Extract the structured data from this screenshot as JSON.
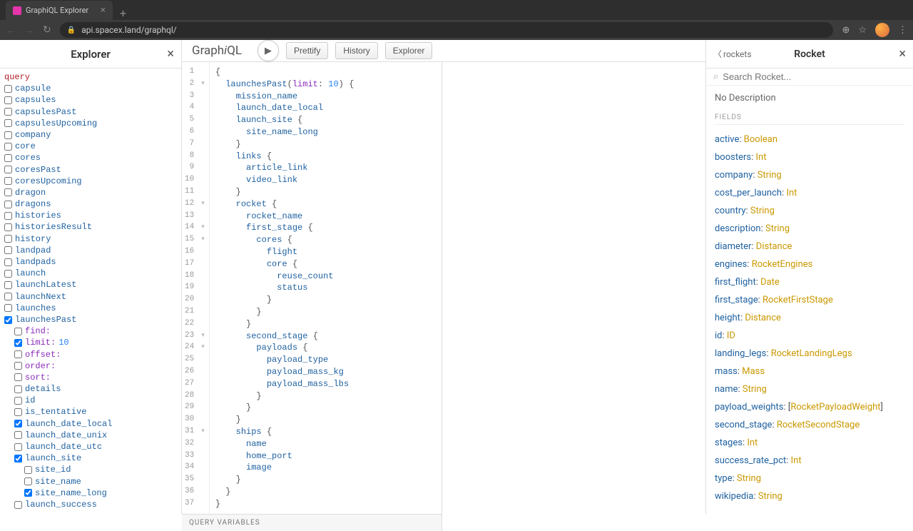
{
  "browser": {
    "tab_title": "GraphiQL Explorer",
    "url": "api.spacex.land/graphql/"
  },
  "explorer": {
    "title": "Explorer",
    "root_keyword": "query",
    "fields": [
      {
        "name": "capsule",
        "indent": 0,
        "checked": false
      },
      {
        "name": "capsules",
        "indent": 0,
        "checked": false
      },
      {
        "name": "capsulesPast",
        "indent": 0,
        "checked": false
      },
      {
        "name": "capsulesUpcoming",
        "indent": 0,
        "checked": false
      },
      {
        "name": "company",
        "indent": 0,
        "checked": false
      },
      {
        "name": "core",
        "indent": 0,
        "checked": false
      },
      {
        "name": "cores",
        "indent": 0,
        "checked": false
      },
      {
        "name": "coresPast",
        "indent": 0,
        "checked": false
      },
      {
        "name": "coresUpcoming",
        "indent": 0,
        "checked": false
      },
      {
        "name": "dragon",
        "indent": 0,
        "checked": false
      },
      {
        "name": "dragons",
        "indent": 0,
        "checked": false
      },
      {
        "name": "histories",
        "indent": 0,
        "checked": false
      },
      {
        "name": "historiesResult",
        "indent": 0,
        "checked": false
      },
      {
        "name": "history",
        "indent": 0,
        "checked": false
      },
      {
        "name": "landpad",
        "indent": 0,
        "checked": false
      },
      {
        "name": "landpads",
        "indent": 0,
        "checked": false
      },
      {
        "name": "launch",
        "indent": 0,
        "checked": false
      },
      {
        "name": "launchLatest",
        "indent": 0,
        "checked": false
      },
      {
        "name": "launchNext",
        "indent": 0,
        "checked": false
      },
      {
        "name": "launches",
        "indent": 0,
        "checked": false
      },
      {
        "name": "launchesPast",
        "indent": 0,
        "checked": true
      },
      {
        "name": "find:",
        "indent": 1,
        "checked": false,
        "arg": true
      },
      {
        "name": "limit:",
        "indent": 1,
        "checked": true,
        "arg": true,
        "value": "10"
      },
      {
        "name": "offset:",
        "indent": 1,
        "checked": false,
        "arg": true
      },
      {
        "name": "order:",
        "indent": 1,
        "checked": false,
        "arg": true
      },
      {
        "name": "sort:",
        "indent": 1,
        "checked": false,
        "arg": true
      },
      {
        "name": "details",
        "indent": 1,
        "checked": false
      },
      {
        "name": "id",
        "indent": 1,
        "checked": false
      },
      {
        "name": "is_tentative",
        "indent": 1,
        "checked": false
      },
      {
        "name": "launch_date_local",
        "indent": 1,
        "checked": true
      },
      {
        "name": "launch_date_unix",
        "indent": 1,
        "checked": false
      },
      {
        "name": "launch_date_utc",
        "indent": 1,
        "checked": false
      },
      {
        "name": "launch_site",
        "indent": 1,
        "checked": true
      },
      {
        "name": "site_id",
        "indent": 2,
        "checked": false
      },
      {
        "name": "site_name",
        "indent": 2,
        "checked": false
      },
      {
        "name": "site_name_long",
        "indent": 2,
        "checked": true
      },
      {
        "name": "launch_success",
        "indent": 1,
        "checked": false
      }
    ]
  },
  "toolbar": {
    "logo": "GraphiQL",
    "prettify": "Prettify",
    "history": "History",
    "explorer": "Explorer"
  },
  "editor": {
    "lines": [
      {
        "n": 1,
        "fold": "",
        "html": "<span class='c-punc'>{</span>"
      },
      {
        "n": 2,
        "fold": "▾",
        "html": "  <span class='c-field'>launchesPast</span><span class='c-punc'>(</span><span class='c-attr'>limit</span><span class='c-punc'>: </span><span class='c-num'>10</span><span class='c-punc'>) {</span>"
      },
      {
        "n": 3,
        "fold": "",
        "html": "    <span class='c-field'>mission_name</span>"
      },
      {
        "n": 4,
        "fold": "",
        "html": "    <span class='c-field'>launch_date_local</span>"
      },
      {
        "n": 5,
        "fold": "",
        "html": "    <span class='c-field'>launch_site</span> <span class='c-punc'>{</span>"
      },
      {
        "n": 6,
        "fold": "",
        "html": "      <span class='c-field'>site_name_long</span>"
      },
      {
        "n": 7,
        "fold": "",
        "html": "    <span class='c-punc'>}</span>"
      },
      {
        "n": 8,
        "fold": "",
        "html": "    <span class='c-field'>links</span> <span class='c-punc'>{</span>"
      },
      {
        "n": 9,
        "fold": "",
        "html": "      <span class='c-field'>article_link</span>"
      },
      {
        "n": 10,
        "fold": "",
        "html": "      <span class='c-field'>video_link</span>"
      },
      {
        "n": 11,
        "fold": "",
        "html": "    <span class='c-punc'>}</span>"
      },
      {
        "n": 12,
        "fold": "▾",
        "html": "    <span class='c-field'>rocket</span> <span class='c-punc'>{</span>"
      },
      {
        "n": 13,
        "fold": "",
        "html": "      <span class='c-field'>rocket_name</span>"
      },
      {
        "n": 14,
        "fold": "▾",
        "html": "      <span class='c-field'>first_stage</span> <span class='c-punc'>{</span>"
      },
      {
        "n": 15,
        "fold": "▾",
        "html": "        <span class='c-field'>cores</span> <span class='c-punc'>{</span>"
      },
      {
        "n": 16,
        "fold": "",
        "html": "          <span class='c-field'>flight</span>"
      },
      {
        "n": 17,
        "fold": "",
        "html": "          <span class='c-field'>core</span> <span class='c-punc'>{</span>"
      },
      {
        "n": 18,
        "fold": "",
        "html": "            <span class='c-field'>reuse_count</span>"
      },
      {
        "n": 19,
        "fold": "",
        "html": "            <span class='c-field'>status</span>"
      },
      {
        "n": 20,
        "fold": "",
        "html": "          <span class='c-punc'>}</span>"
      },
      {
        "n": 21,
        "fold": "",
        "html": "        <span class='c-punc'>}</span>"
      },
      {
        "n": 22,
        "fold": "",
        "html": "      <span class='c-punc'>}</span>"
      },
      {
        "n": 23,
        "fold": "▾",
        "html": "      <span class='c-field'>second_stage</span> <span class='c-punc'>{</span>"
      },
      {
        "n": 24,
        "fold": "▾",
        "html": "        <span class='c-field'>payloads</span> <span class='c-punc'>{</span>"
      },
      {
        "n": 25,
        "fold": "",
        "html": "          <span class='c-field'>payload_type</span>"
      },
      {
        "n": 26,
        "fold": "",
        "html": "          <span class='c-field'>payload_mass_kg</span>"
      },
      {
        "n": 27,
        "fold": "",
        "html": "          <span class='c-field'>payload_mass_lbs</span>"
      },
      {
        "n": 28,
        "fold": "",
        "html": "        <span class='c-punc'>}</span>"
      },
      {
        "n": 29,
        "fold": "",
        "html": "      <span class='c-punc'>}</span>"
      },
      {
        "n": 30,
        "fold": "",
        "html": "    <span class='c-punc'>}</span>"
      },
      {
        "n": 31,
        "fold": "▾",
        "html": "    <span class='c-field'>ships</span> <span class='c-punc'>{</span>"
      },
      {
        "n": 32,
        "fold": "",
        "html": "      <span class='c-field'>name</span>"
      },
      {
        "n": 33,
        "fold": "",
        "html": "      <span class='c-field'>home_port</span>"
      },
      {
        "n": 34,
        "fold": "",
        "html": "      <span class='c-field'>image</span>"
      },
      {
        "n": 35,
        "fold": "",
        "html": "    <span class='c-punc'>}</span>"
      },
      {
        "n": 36,
        "fold": "",
        "html": "  <span class='c-punc'>}</span>"
      },
      {
        "n": 37,
        "fold": "",
        "html": "<span class='c-punc'>}</span>"
      }
    ],
    "vars_label": "QUERY VARIABLES"
  },
  "docs": {
    "back_label": "rockets",
    "title": "Rocket",
    "search_placeholder": "Search Rocket...",
    "description": "No Description",
    "section_label": "FIELDS",
    "fields": [
      {
        "name": "active",
        "type": "Boolean"
      },
      {
        "name": "boosters",
        "type": "Int"
      },
      {
        "name": "company",
        "type": "String"
      },
      {
        "name": "cost_per_launch",
        "type": "Int"
      },
      {
        "name": "country",
        "type": "String"
      },
      {
        "name": "description",
        "type": "String"
      },
      {
        "name": "diameter",
        "type": "Distance"
      },
      {
        "name": "engines",
        "type": "RocketEngines"
      },
      {
        "name": "first_flight",
        "type": "Date"
      },
      {
        "name": "first_stage",
        "type": "RocketFirstStage"
      },
      {
        "name": "height",
        "type": "Distance"
      },
      {
        "name": "id",
        "type": "ID"
      },
      {
        "name": "landing_legs",
        "type": "RocketLandingLegs"
      },
      {
        "name": "mass",
        "type": "Mass"
      },
      {
        "name": "name",
        "type": "String"
      },
      {
        "name": "payload_weights",
        "type": "[RocketPayloadWeight]",
        "bracket": true
      },
      {
        "name": "second_stage",
        "type": "RocketSecondStage"
      },
      {
        "name": "stages",
        "type": "Int"
      },
      {
        "name": "success_rate_pct",
        "type": "Int"
      },
      {
        "name": "type",
        "type": "String"
      },
      {
        "name": "wikipedia",
        "type": "String"
      }
    ]
  }
}
